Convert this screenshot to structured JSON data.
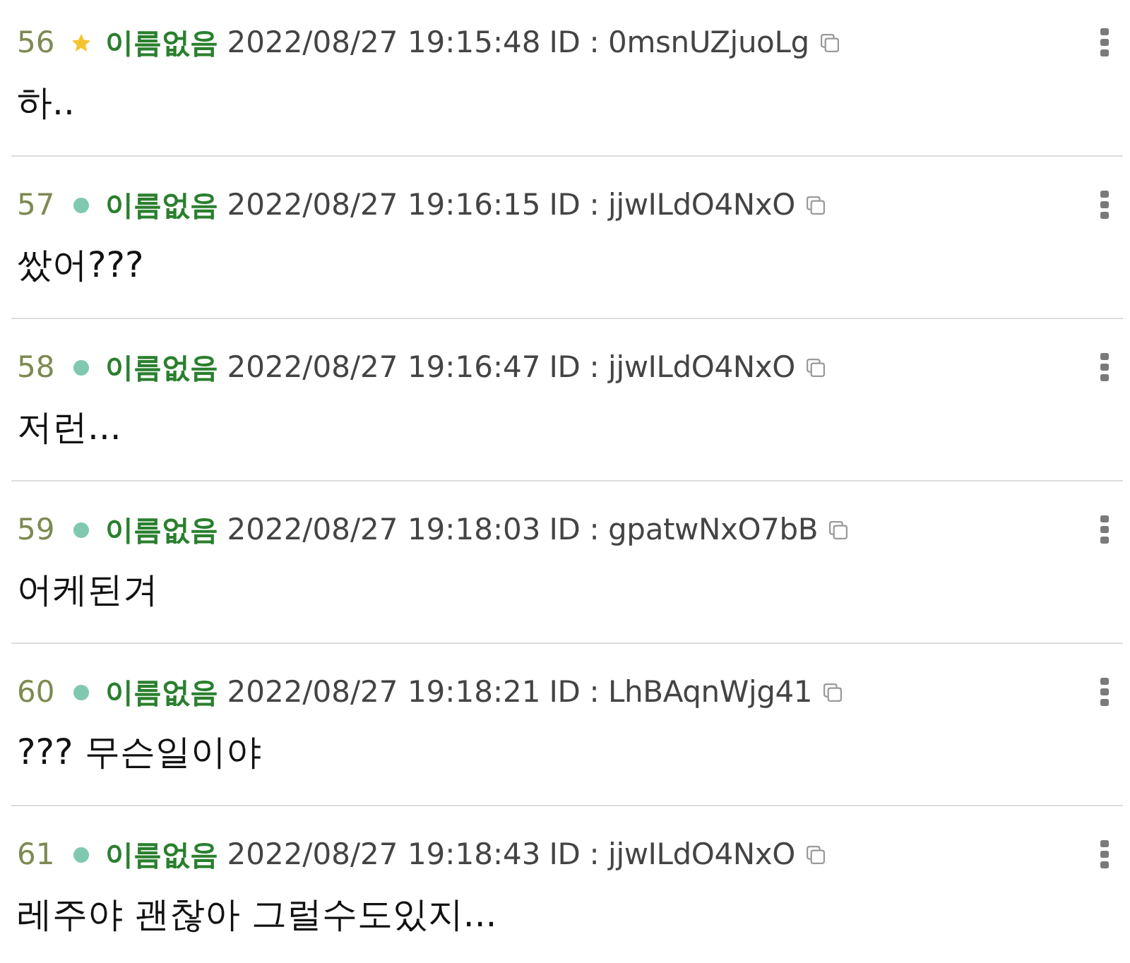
{
  "posts": [
    {
      "number": "56",
      "starred": true,
      "name": "이름없음",
      "date": "2022/08/27 19:15:48",
      "id": "ID : 0msnUZjuoLg",
      "text": "하.."
    },
    {
      "number": "57",
      "starred": false,
      "name": "이름없음",
      "date": "2022/08/27 19:16:15",
      "id": "ID : jjwILdO4NxO",
      "text": "쌌어???"
    },
    {
      "number": "58",
      "starred": false,
      "name": "이름없음",
      "date": "2022/08/27 19:16:47",
      "id": "ID : jjwILdO4NxO",
      "text": "저런..."
    },
    {
      "number": "59",
      "starred": false,
      "name": "이름없음",
      "date": "2022/08/27 19:18:03",
      "id": "ID : gpatwNxO7bB",
      "text": "어케된겨"
    },
    {
      "number": "60",
      "starred": false,
      "name": "이름없음",
      "date": "2022/08/27 19:18:21",
      "id": "ID : LhBAqnWjg41",
      "text": "??? 무슨일이야"
    },
    {
      "number": "61",
      "starred": false,
      "name": "이름없음",
      "date": "2022/08/27 19:18:43",
      "id": "ID : jjwILdO4NxO",
      "text": "레주야 괜찮아 그럴수도있지..."
    }
  ]
}
